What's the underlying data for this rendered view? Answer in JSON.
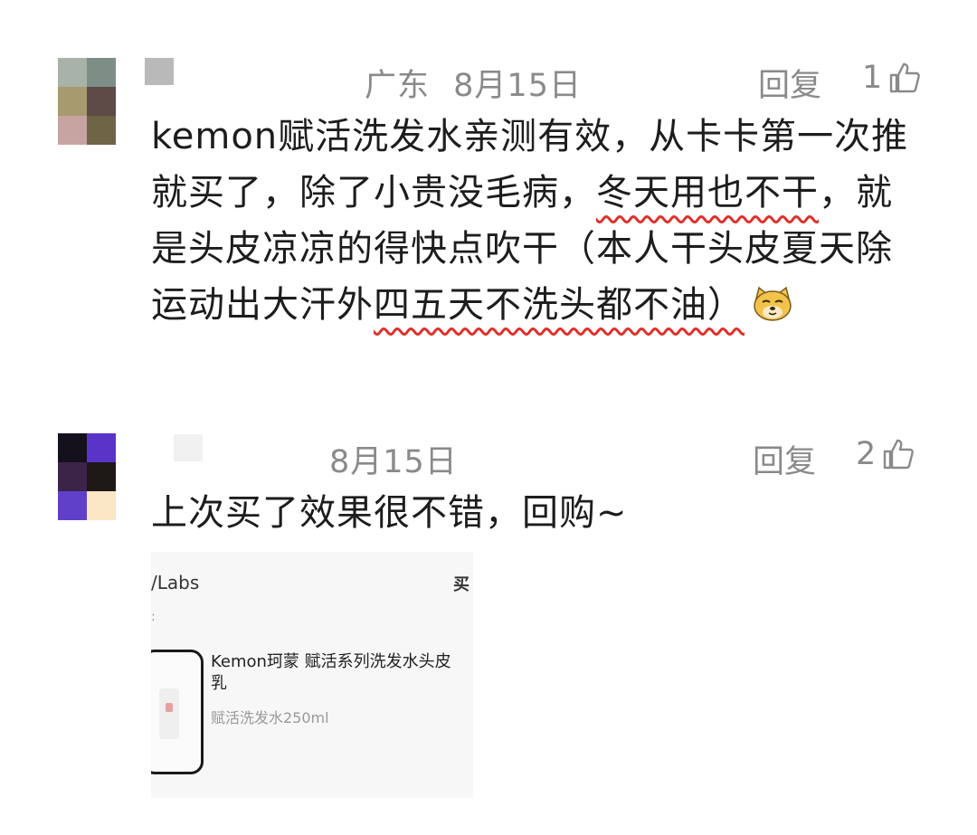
{
  "comments": [
    {
      "location": "广东",
      "date": "8月15日",
      "reply_label": "回复",
      "like_count": "1",
      "text_lines": [
        "kemon赋活洗发水亲测有效，从卡卡第一次推",
        "就买了，除了小贵没毛病，",
        "冬天用也不干",
        "，就",
        "是头皮凉凉的得快点吹干（本人干头皮夏天除",
        "运动出大汗外",
        "四五天不洗头都不油）"
      ],
      "emoji": "cat-face-emoji"
    },
    {
      "date": "8月15日",
      "reply_label": "回复",
      "like_count": "2",
      "text": "上次买了效果很不错，回购~",
      "product_card": {
        "brand": "/Labs",
        "buy_label": "买",
        "dot": ":",
        "title": "Kemon珂蒙 赋活系列洗发水头皮乳",
        "spec": "赋活洗发水250ml"
      }
    }
  ],
  "colors": {
    "meta_gray": "#8a8a8a",
    "highlight_underline": "#e0302a",
    "text": "#1d1d1d"
  }
}
